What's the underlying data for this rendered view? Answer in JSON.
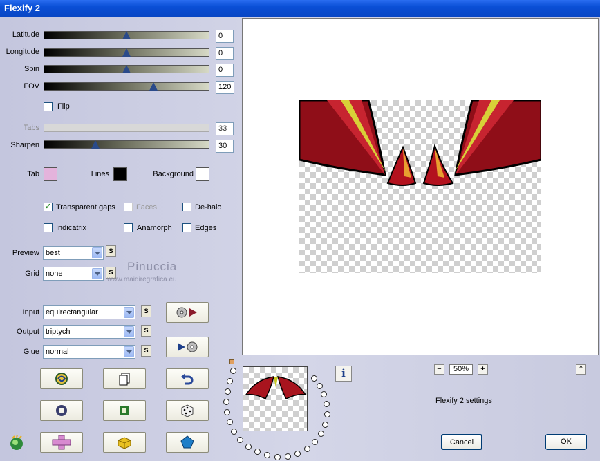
{
  "window": {
    "title": "Flexify 2"
  },
  "sliders": [
    {
      "label": "Latitude",
      "value": "0",
      "level": 0.5,
      "enabled": true
    },
    {
      "label": "Longitude",
      "value": "0",
      "level": 0.5,
      "enabled": true
    },
    {
      "label": "Spin",
      "value": "0",
      "level": 0.5,
      "enabled": true
    },
    {
      "label": "FOV",
      "value": "120",
      "level": 0.67,
      "enabled": true
    },
    {
      "label": "Tabs",
      "value": "33",
      "level": null,
      "enabled": false
    },
    {
      "label": "Sharpen",
      "value": "30",
      "level": 0.3,
      "enabled": true
    }
  ],
  "flip": {
    "label": "Flip",
    "checked": false
  },
  "colors": {
    "tab": {
      "label": "Tab",
      "color": "#e4b3dc"
    },
    "lines": {
      "label": "Lines",
      "color": "#000000"
    },
    "background": {
      "label": "Background",
      "color": "#ffffff"
    }
  },
  "checks": {
    "transparent_gaps": {
      "label": "Transparent gaps",
      "checked": true
    },
    "faces": {
      "label": "Faces",
      "checked": false,
      "enabled": false
    },
    "de_halo": {
      "label": "De-halo",
      "checked": false
    },
    "indicatrix": {
      "label": "Indicatrix",
      "checked": false
    },
    "anamorph": {
      "label": "Anamorph",
      "checked": false
    },
    "edges": {
      "label": "Edges",
      "checked": false
    }
  },
  "preview_select": {
    "label": "Preview",
    "value": "best"
  },
  "grid_select": {
    "label": "Grid",
    "value": "none"
  },
  "input_select": {
    "label": "Input",
    "value": "equirectangular"
  },
  "output_select": {
    "label": "Output",
    "value": "triptych"
  },
  "glue_select": {
    "label": "Glue",
    "value": "normal"
  },
  "s_label": "S",
  "watermark": {
    "name": "Pinuccia",
    "url": "www.maidiregrafica.eu"
  },
  "zoom": {
    "minus": "−",
    "value": "50%",
    "plus": "+"
  },
  "collapse_label": "^",
  "info_label": "i",
  "settings_label": "Flexify 2 settings",
  "buttons": {
    "cancel": "Cancel",
    "ok": "OK"
  },
  "accent": "#0a4fd6"
}
